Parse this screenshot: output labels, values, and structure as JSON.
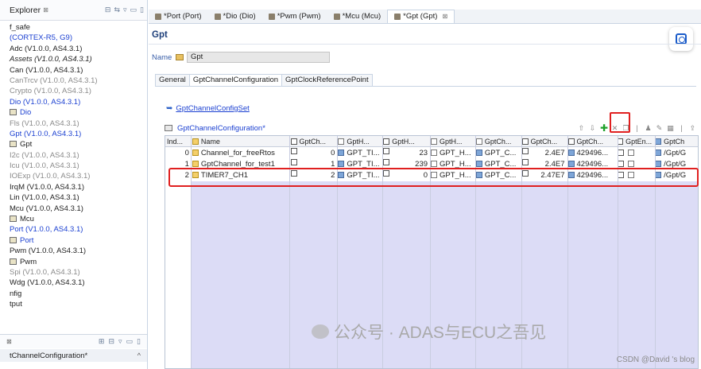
{
  "explorer": {
    "title": "Explorer",
    "close_glyph": "⊠",
    "items": [
      {
        "label": "f_safe",
        "style": "",
        "icon": ""
      },
      {
        "label": "(CORTEX-R5, G9)",
        "style": "blue",
        "icon": ""
      },
      {
        "label": "Adc (V1.0.0, AS4.3.1)",
        "style": "",
        "icon": ""
      },
      {
        "label": "Assets (V1.0.0, AS4.3.1)",
        "style": "italic",
        "icon": ""
      },
      {
        "label": "Can (V1.0.0, AS4.3.1)",
        "style": "",
        "icon": ""
      },
      {
        "label": "CanTrcv (V1.0.0, AS4.3.1)",
        "style": "grey",
        "icon": ""
      },
      {
        "label": "Crypto (V1.0.0, AS4.3.1)",
        "style": "grey",
        "icon": ""
      },
      {
        "label": "Dio (V1.0.0, AS4.3.1)",
        "style": "blue",
        "icon": ""
      },
      {
        "label": "Dio",
        "style": "blue",
        "icon": "module"
      },
      {
        "label": "Fls (V1.0.0, AS4.3.1)",
        "style": "grey",
        "icon": ""
      },
      {
        "label": "Gpt (V1.0.0, AS4.3.1)",
        "style": "blue",
        "icon": ""
      },
      {
        "label": "Gpt",
        "style": "",
        "icon": "module"
      },
      {
        "label": "I2c (V1.0.0, AS4.3.1)",
        "style": "grey",
        "icon": ""
      },
      {
        "label": "Icu (V1.0.0, AS4.3.1)",
        "style": "grey",
        "icon": ""
      },
      {
        "label": "IOExp (V1.0.0, AS4.3.1)",
        "style": "grey",
        "icon": ""
      },
      {
        "label": "IrqM (V1.0.0, AS4.3.1)",
        "style": "",
        "icon": ""
      },
      {
        "label": "Lin (V1.0.0, AS4.3.1)",
        "style": "",
        "icon": ""
      },
      {
        "label": "Mcu (V1.0.0, AS4.3.1)",
        "style": "",
        "icon": ""
      },
      {
        "label": "Mcu",
        "style": "",
        "icon": "module"
      },
      {
        "label": "Port (V1.0.0, AS4.3.1)",
        "style": "blue",
        "icon": ""
      },
      {
        "label": "Port",
        "style": "blue",
        "icon": "module"
      },
      {
        "label": "Pwm (V1.0.0, AS4.3.1)",
        "style": "",
        "icon": ""
      },
      {
        "label": "Pwm",
        "style": "",
        "icon": "module"
      },
      {
        "label": "Spi (V1.0.0, AS4.3.1)",
        "style": "grey",
        "icon": ""
      },
      {
        "label": "Wdg (V1.0.0, AS4.3.1)",
        "style": "",
        "icon": ""
      },
      {
        "label": "nfig",
        "style": "",
        "icon": ""
      },
      {
        "label": "tput",
        "style": "",
        "icon": ""
      }
    ],
    "bottom_glyph": "⊠",
    "bottom_field": "tChannelConfiguration*",
    "bottom_chevron": "^"
  },
  "tabs": [
    {
      "label": "*Port (Port)",
      "active": false
    },
    {
      "label": "*Dio (Dio)",
      "active": false
    },
    {
      "label": "*Pwm (Pwm)",
      "active": false
    },
    {
      "label": "*Mcu (Mcu)",
      "active": false
    },
    {
      "label": "*Gpt (Gpt)",
      "active": true
    }
  ],
  "tab_close_glyph": "⊠",
  "editor": {
    "title": "Gpt",
    "name_label": "Name",
    "name_value": "Gpt",
    "subtabs": [
      "General",
      "GptChannelConfiguration",
      "GptClockReferencePoint"
    ],
    "active_subtab": 1,
    "configset_link": "GptChannelConfigSet",
    "section_title": "GptChannelConfiguration*",
    "toolbar": {
      "up_icon": "arrow-up-icon",
      "down_icon": "arrow-down-icon",
      "add_icon": "plus-icon",
      "add_glyph": "✚",
      "delete_icon": "delete-icon",
      "copy_icon": "copy-icon",
      "edit_icon": "pencil-icon",
      "table_icon": "table-icon",
      "export_icon": "export-icon"
    }
  },
  "grid": {
    "columns": [
      "Ind...",
      "Name",
      "GptCh...",
      "GptH...",
      "GptH...",
      "GptH...",
      "GptCh...",
      "GptCh...",
      "GptCh...",
      "GptEn...",
      "GptCh"
    ],
    "rows": [
      {
        "index": "0",
        "name": "Channel_for_freeRtos",
        "c1": "0",
        "c2": "GPT_TI...",
        "c3": "23",
        "c4": "GPT_H...",
        "c5": "GPT_C...",
        "c6": "2.4E7",
        "c7": "429496...",
        "c9": "/Gpt/G"
      },
      {
        "index": "1",
        "name": "GptChannel_for_test1",
        "c1": "1",
        "c2": "GPT_TI...",
        "c3": "239",
        "c4": "GPT_H...",
        "c5": "GPT_C...",
        "c6": "2.4E7",
        "c7": "429496...",
        "c9": "/Gpt/G"
      },
      {
        "index": "2",
        "name": "TIMER7_CH1",
        "c1": "2",
        "c2": "GPT_TI...",
        "c3": "0",
        "c4": "GPT_H...",
        "c5": "GPT_C...",
        "c6": "2.47E7",
        "c7": "429496...",
        "c9": "/Gpt/G"
      }
    ],
    "selected_row": 2
  },
  "watermark": "公众号 · ADAS与ECU之吾见",
  "credit": "CSDN @David 's blog",
  "colors": {
    "accent_blue": "#1a3fd1",
    "highlight_red": "#e02020",
    "grid_fill": "#dcdcf6"
  }
}
